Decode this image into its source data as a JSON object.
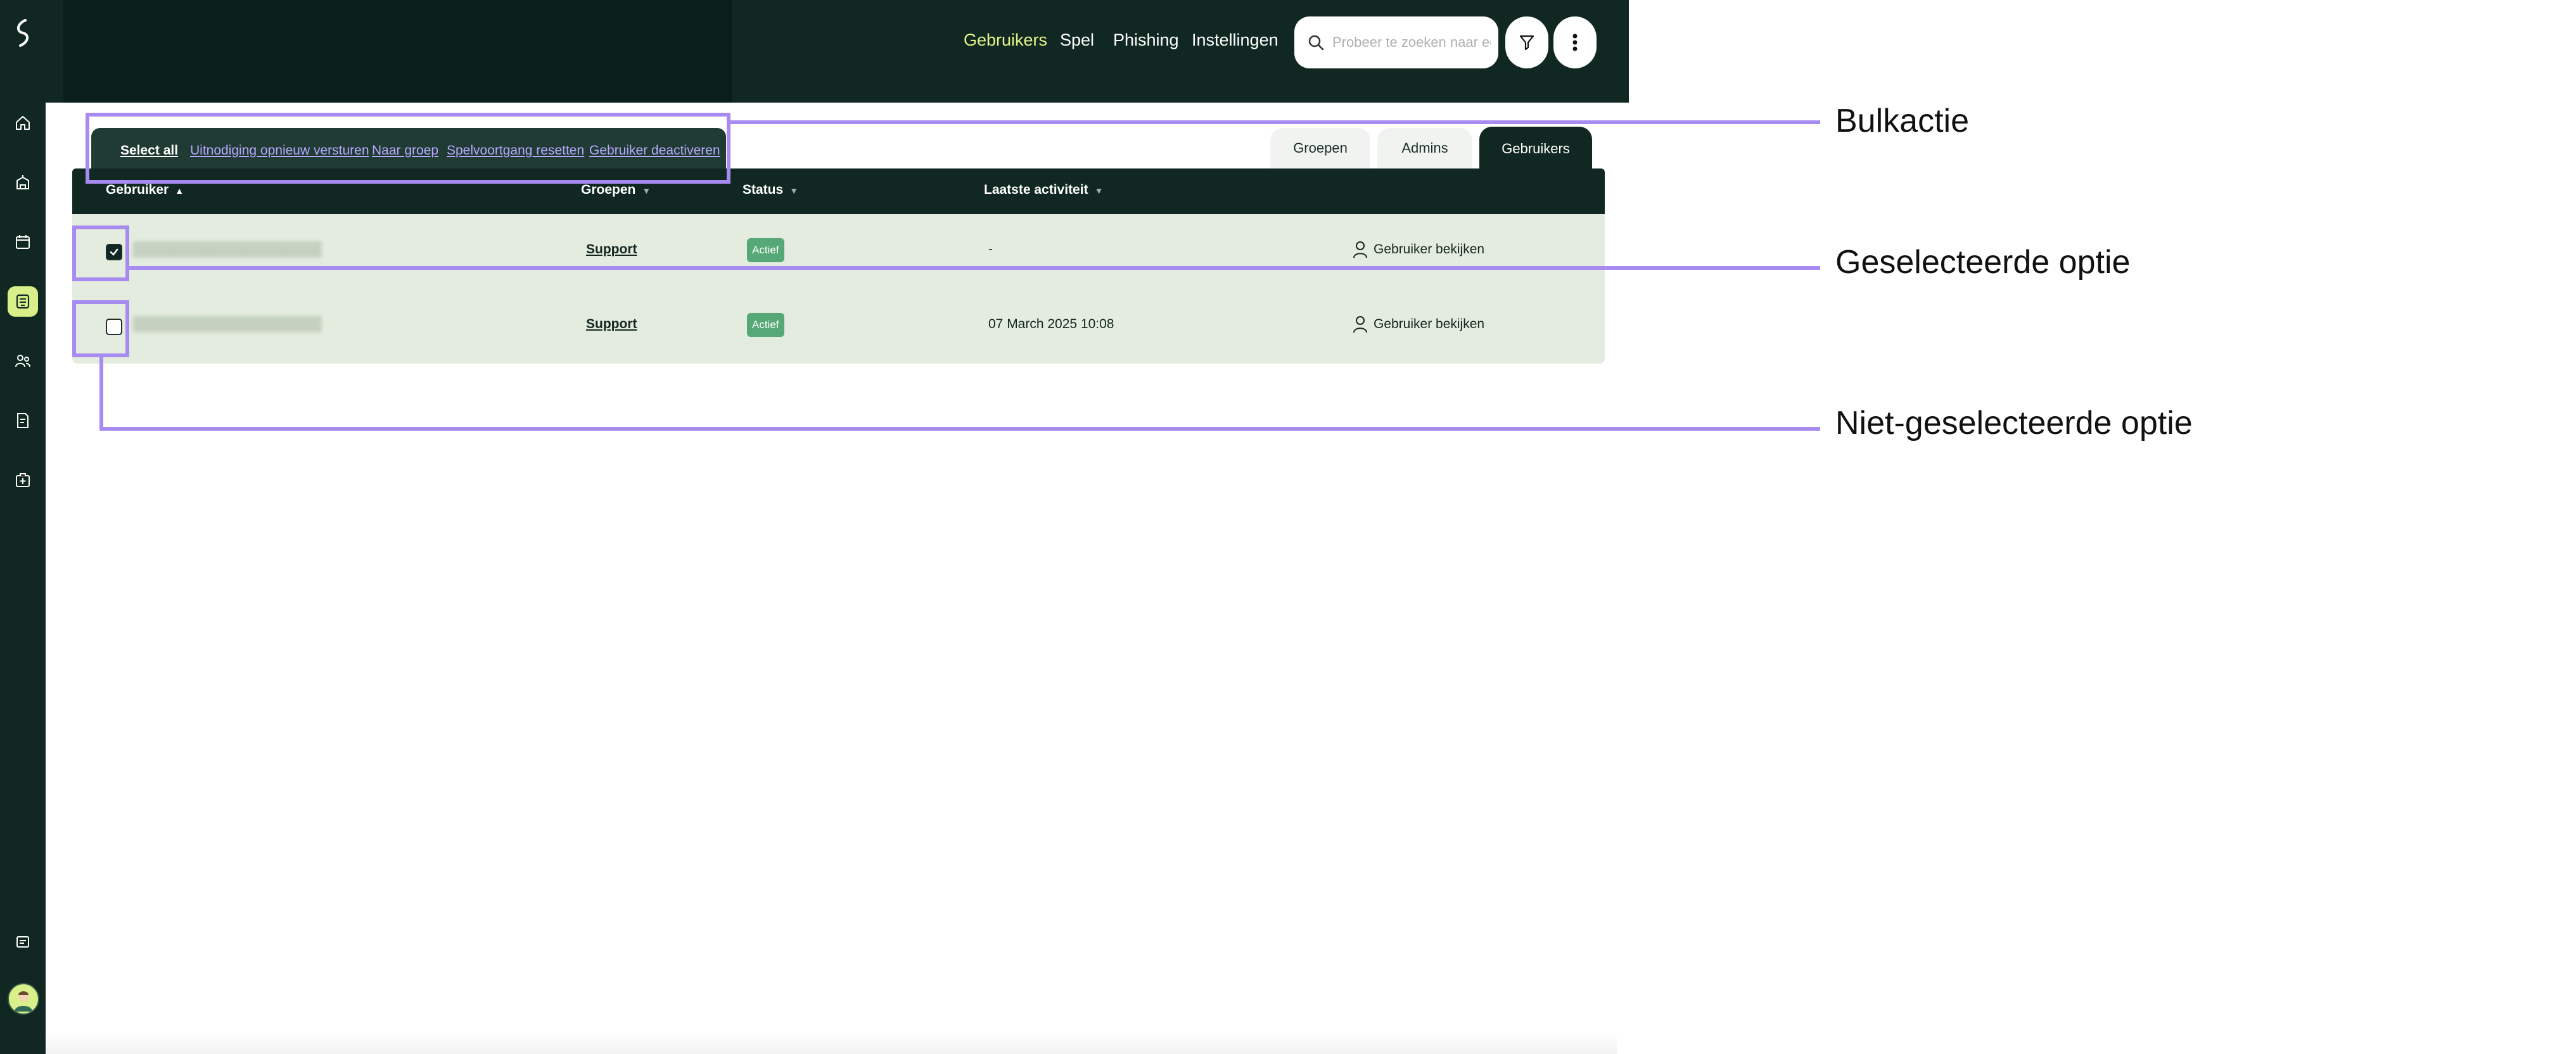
{
  "nav": {
    "items": [
      {
        "label": "Gebruikers",
        "active": true
      },
      {
        "label": "Spel",
        "active": false
      },
      {
        "label": "Phishing",
        "active": false
      },
      {
        "label": "Instellingen",
        "active": false
      }
    ]
  },
  "search": {
    "placeholder": "Probeer te zoeken naar een r"
  },
  "sidebar": {
    "icons": [
      "home-icon",
      "building-icon",
      "calendar-icon",
      "game-icon",
      "users-icon",
      "report-icon",
      "briefcase-plus-icon",
      "message-icon"
    ],
    "active_icon": "game-icon"
  },
  "bulk_actions": {
    "select_all": "Select all",
    "resend_invitation": "Uitnodiging opnieuw versturen",
    "to_group": "Naar groep",
    "reset_progress": "Spelvoortgang resetten",
    "deactivate_user": "Gebruiker deactiveren"
  },
  "tabs": [
    {
      "label": "Groepen",
      "active": false
    },
    {
      "label": "Admins",
      "active": false
    },
    {
      "label": "Gebruikers",
      "active": true
    }
  ],
  "table": {
    "columns": {
      "user": "Gebruiker",
      "groups": "Groepen",
      "status": "Status",
      "last_activity": "Laatste activiteit"
    },
    "rows": [
      {
        "selected": true,
        "group": "Support",
        "status": "Actief",
        "last_activity": "-",
        "action": "Gebruiker bekijken"
      },
      {
        "selected": false,
        "group": "Support",
        "status": "Actief",
        "last_activity": "07 March 2025 10:08",
        "action": "Gebruiker bekijken"
      }
    ]
  },
  "annotations": {
    "bulk_action": "Bulkactie",
    "selected_option": "Geselecteerde optie",
    "unselected_option": "Niet-geselecteerde optie"
  },
  "colors": {
    "dark_green": "#112822",
    "accent_yellow": "#e7f28c",
    "row_background": "#e4ecdf",
    "status_green": "#56a877",
    "link_purple": "#b9a8ff",
    "annotation_purple": "#a78bf0"
  }
}
